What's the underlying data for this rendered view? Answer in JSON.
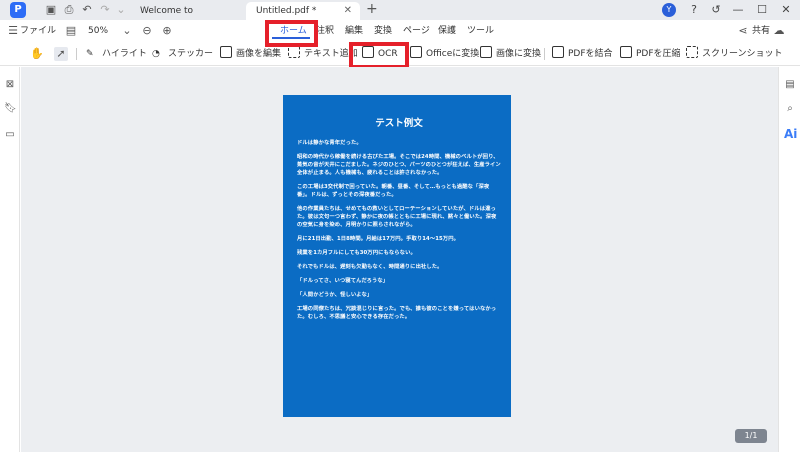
{
  "titlebar": {
    "logo_text": "P",
    "tabs": [
      {
        "label": "Welcome to PDNob.pdf"
      },
      {
        "label": "Untitled.pdf *"
      }
    ],
    "avatar_letter": "Y",
    "icons": [
      "save-icon",
      "print-icon",
      "undo-icon",
      "redo-icon",
      "chevron-down-icon",
      "add-tab-icon",
      "help-icon",
      "restore-icon",
      "minimize-icon",
      "maximize-icon",
      "close-icon"
    ]
  },
  "menu": {
    "file": "ファイル",
    "zoom": "50%",
    "items": [
      "ホーム",
      "注釈",
      "編集",
      "変換",
      "ページ",
      "保護",
      "ツール"
    ],
    "active_index": 0,
    "share": "共有"
  },
  "toolbar": {
    "tools": [
      "ハイライト",
      "ステッカー",
      "画像を編集",
      "テキスト追加",
      "OCR",
      "Officeに変換",
      "画像に変換",
      "PDFを結合",
      "PDFを圧縮",
      "スクリーンショット"
    ]
  },
  "document": {
    "title": "テスト例文",
    "paragraphs": [
      "ドルは静かな青年だった。",
      "昭和の時代から稼働を続ける古びた工場。そこでは24時間、機械のベルトが回り、蒸気の音が天井にこだました。ネジのひとつ、パーツのひとつが狂えば、生産ライン全体が止まる。人も機械も、疲れることは許されなかった。",
      "この工場は3交代制で回っていた。朝番、昼番、そして…もっとも過酷な「深夜番」。ドルは、ずっとその深夜番だった。",
      "他の作業員たちは、せめてもの救いとしてローテーションしていたが、ドルは違った。彼は文句一つ言わず、静かに夜の帳とともに工場に現れ、黙々と働いた。深夜の空気に身を染め、月明かりに照らされながら。",
      "月に21日出勤、1日8時間。月給は17万円。手取り14〜15万円。",
      "残業を1カ月フルにしても30万円にもならない。",
      "それでもドルは、遅刻も欠勤もなく、時間通りに出社した。",
      "「ドルってさ、いつ寝てんだろうな」",
      "「人間かどうか、怪しいよな」",
      "工場の同僚たちは、冗談混じりに言った。でも、誰も彼のことを嫌ってはいなかった。むしろ、不思議と安心できる存在だった。"
    ]
  },
  "page_indicator": "1/1",
  "colors": {
    "accent": "#2b5fd9",
    "highlight_box": "#e5202a",
    "page_background": "#0b6cc4",
    "canvas_background": "#eceef1"
  }
}
